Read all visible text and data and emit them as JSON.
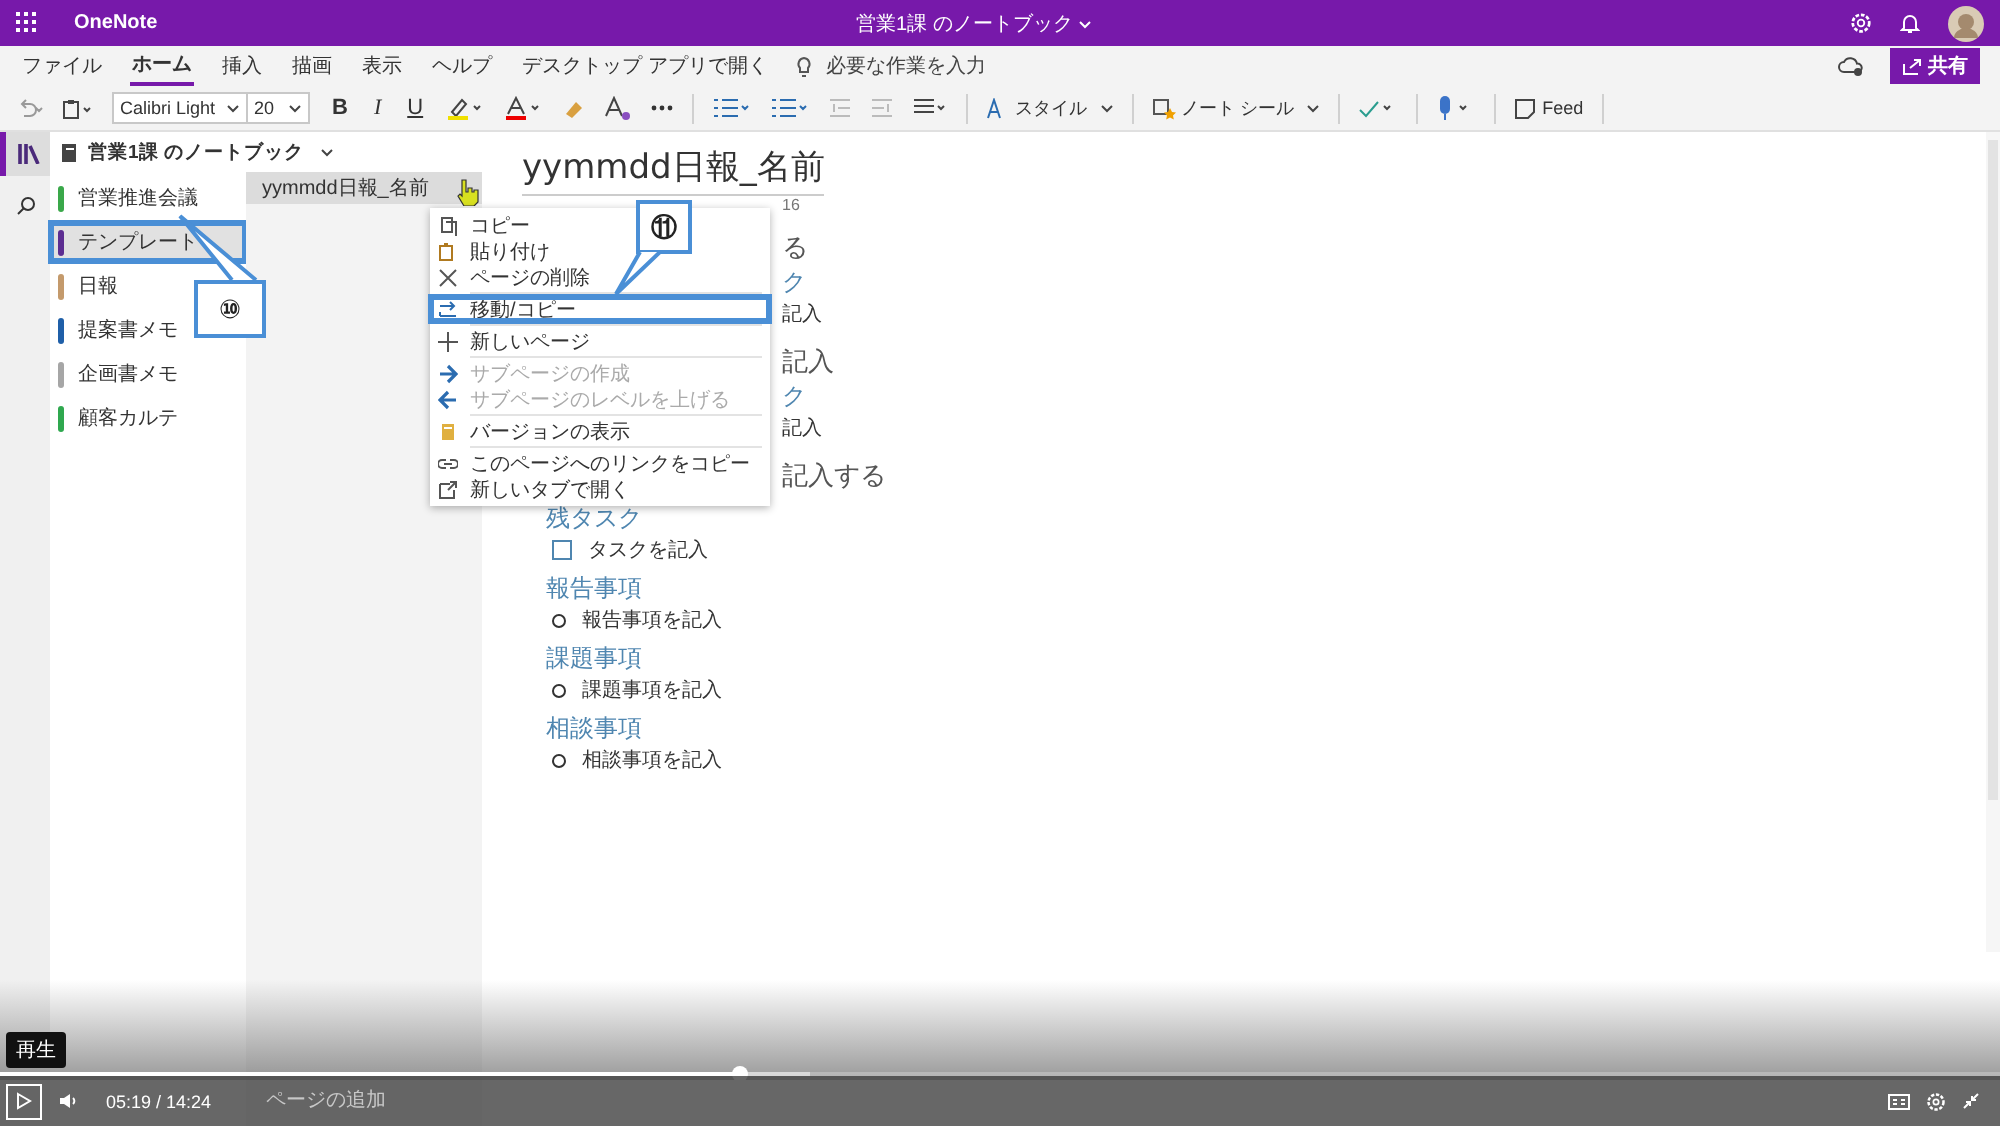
{
  "titlebar": {
    "app": "OneNote",
    "notebook": "営業1課 のノートブック"
  },
  "ribbon": {
    "tabs": [
      {
        "label": "ファイル",
        "selected": false
      },
      {
        "label": "ホーム",
        "selected": true
      },
      {
        "label": "挿入",
        "selected": false
      },
      {
        "label": "描画",
        "selected": false
      },
      {
        "label": "表示",
        "selected": false
      },
      {
        "label": "ヘルプ",
        "selected": false
      }
    ],
    "open_desktop": "デスクトップ アプリで開く",
    "search_placeholder": "必要な作業を入力",
    "share": "共有"
  },
  "toolbar": {
    "font": "Calibri Light",
    "size": "20",
    "bold": "B",
    "italic": "I",
    "underline": "U",
    "styles": "スタイル",
    "tags": "ノート シール",
    "feed": "Feed"
  },
  "notebook_header": "営業1課 のノートブック",
  "sections": [
    {
      "name": "営業推進会議",
      "color": "#3aa84a",
      "selected": false,
      "highlighted": false
    },
    {
      "name": "テンプレート",
      "color": "#5c2d91",
      "selected": true,
      "highlighted": true
    },
    {
      "name": "日報",
      "color": "#c49a6c",
      "selected": false,
      "highlighted": false
    },
    {
      "name": "提案書メモ",
      "color": "#1f5fa8",
      "selected": false,
      "highlighted": false
    },
    {
      "name": "企画書メモ",
      "color": "#a6a6a6",
      "selected": false,
      "highlighted": false
    },
    {
      "name": "顧客カルテ",
      "color": "#2fa84f",
      "selected": false,
      "highlighted": false
    }
  ],
  "pages": [
    {
      "title": "yymmdd日報_名前",
      "selected": true
    }
  ],
  "pages_footer": "ページの追加",
  "context_menu": {
    "groups": [
      [
        {
          "label": "コピー",
          "disabled": false,
          "highlighted": false
        },
        {
          "label": "貼り付け",
          "disabled": false,
          "highlighted": false
        },
        {
          "label": "ページの削除",
          "disabled": false,
          "highlighted": false
        }
      ],
      [
        {
          "label": "移動/コピー",
          "disabled": false,
          "highlighted": true
        }
      ],
      [
        {
          "label": "新しいページ",
          "disabled": false,
          "highlighted": false
        }
      ],
      [
        {
          "label": "サブページの作成",
          "disabled": true,
          "highlighted": false
        },
        {
          "label": "サブページのレベルを上げる",
          "disabled": true,
          "highlighted": false
        }
      ],
      [
        {
          "label": "バージョンの表示",
          "disabled": false,
          "highlighted": false
        }
      ],
      [
        {
          "label": "このページへのリンクをコピー",
          "disabled": false,
          "highlighted": false
        },
        {
          "label": "新しいタブで開く",
          "disabled": false,
          "highlighted": false
        }
      ]
    ]
  },
  "page": {
    "title": "yymmdd日報_名前",
    "date_fragment": "16",
    "fragments": [
      {
        "kind": "heading",
        "text": "る"
      },
      {
        "kind": "subheading",
        "text": "ク"
      },
      {
        "kind": "body",
        "text": "記入"
      },
      {
        "kind": "heading",
        "text": "記入"
      },
      {
        "kind": "subheading",
        "text": "ク"
      },
      {
        "kind": "body",
        "text": "記入"
      },
      {
        "kind": "heading",
        "text": "記入する"
      }
    ],
    "blocks": [
      {
        "heading": "残タスク",
        "kind": "task",
        "checked": false,
        "item": "タスクを記入"
      },
      {
        "heading": "報告事項",
        "kind": "bullet",
        "item": "報告事項を記入"
      },
      {
        "heading": "課題事項",
        "kind": "bullet",
        "item": "課題事項を記入"
      },
      {
        "heading": "相談事項",
        "kind": "bullet",
        "item": "相談事項を記入"
      }
    ]
  },
  "annotations": [
    {
      "text": "⑩"
    },
    {
      "text": "⑪"
    }
  ],
  "player": {
    "tooltip": "再生",
    "time": "05:19 / 14:24",
    "level": 0.37
  }
}
